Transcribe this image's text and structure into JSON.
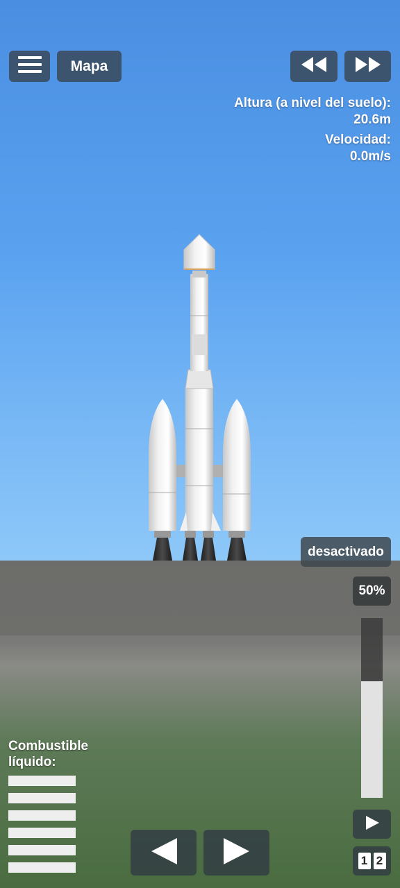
{
  "top_bar": {
    "map_label": "Mapa"
  },
  "telemetry": {
    "altitude_label": "Altura (a nivel del suelo):",
    "altitude_value": "20.6m",
    "velocity_label": "Velocidad:",
    "velocity_value": "0.0m/s"
  },
  "stage_control": {
    "status_label": "desactivado",
    "throttle_label": "50%",
    "throttle_level": 0.65
  },
  "fuel": {
    "label_line1": "Combustible",
    "label_line2": "líquido:"
  },
  "bottom_bar": {
    "stage_1": "1",
    "stage_2": "2"
  },
  "icons": {
    "menu": "menu-icon",
    "rewind": "rewind-icon",
    "fast_forward": "fast-forward-icon",
    "rotate_left": "rotate-left-icon",
    "rotate_right": "rotate-right-icon",
    "play": "play-icon"
  },
  "colors": {
    "sky_top": "#4b8fe0",
    "sky_bottom": "#8cc6f8",
    "ground_gray": "#6e6e6c",
    "grass": "#4e6e44",
    "button_bg": "#3c4e64"
  }
}
